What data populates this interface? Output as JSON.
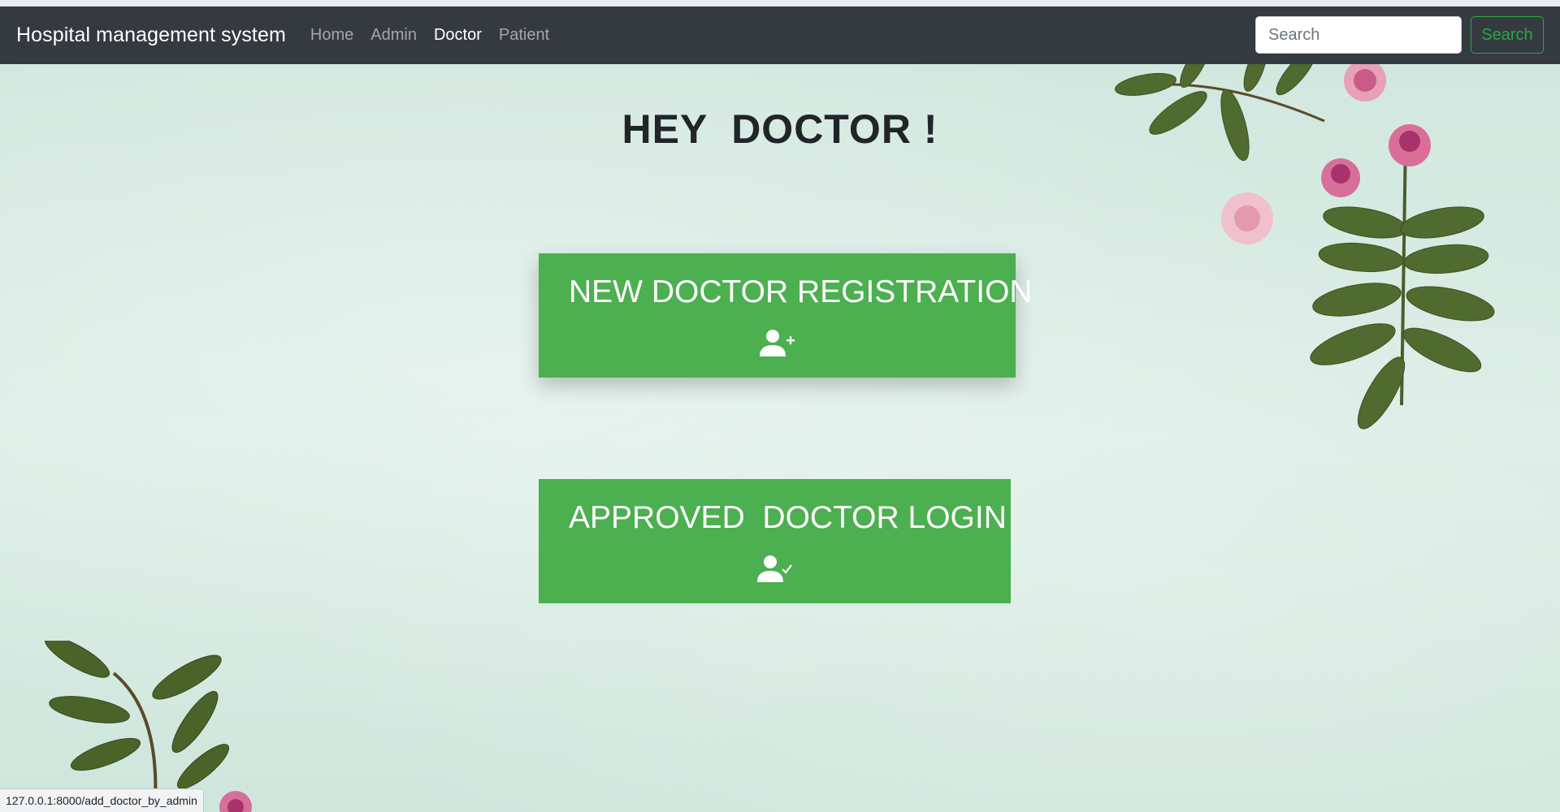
{
  "navbar": {
    "brand": "Hospital management system",
    "links": [
      {
        "label": "Home",
        "active": false
      },
      {
        "label": "Admin",
        "active": false
      },
      {
        "label": "Doctor",
        "active": true
      },
      {
        "label": "Patient",
        "active": false
      }
    ],
    "search_placeholder": "Search",
    "search_button": "Search"
  },
  "main": {
    "heading": "HEY  DOCTOR !",
    "cards": [
      {
        "title": "NEW DOCTOR REGISTRATION",
        "icon": "user-plus-icon"
      },
      {
        "title": "APPROVED  DOCTOR LOGIN",
        "icon": "user-check-icon"
      }
    ]
  },
  "status_bar": {
    "url": "127.0.0.1:8000/add_doctor_by_admin"
  },
  "colors": {
    "navbar": "#343a40",
    "card": "#4caf50",
    "search_button": "#28a745",
    "background": "#d6ebe3"
  }
}
